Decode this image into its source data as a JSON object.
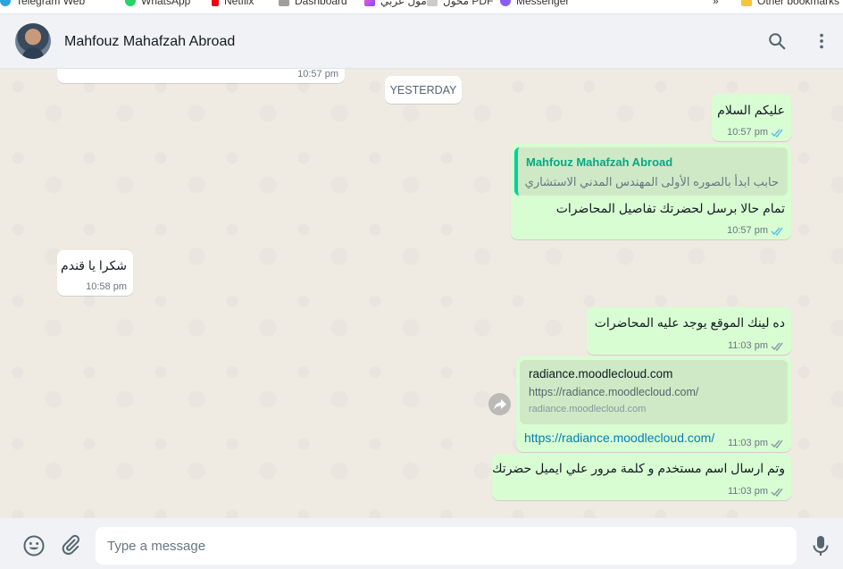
{
  "bookmarks": {
    "items": [
      {
        "label": "Telegram Web",
        "color": "#2aa3df"
      },
      {
        "label": "WhatsApp",
        "color": "#25d366"
      },
      {
        "label": "Netflix",
        "color": "#e50914"
      },
      {
        "label": "Dashboard",
        "color": "#9e9e9e"
      },
      {
        "label": "مول عربي",
        "color": "#a64dff"
      },
      {
        "label": "محول PDF",
        "color": "#cccccc"
      },
      {
        "label": "Messenger",
        "color": "#8a5cf6"
      }
    ],
    "more": "»",
    "other": "Other bookmarks"
  },
  "header": {
    "contact_name": "Mahfouz Mahafzah Abroad",
    "icons": [
      "search-icon",
      "menu-icon"
    ]
  },
  "chat": {
    "date_chip": "YESTERDAY",
    "top_partial_time": "10:57 pm",
    "messages": [
      {
        "dir": "out",
        "text": "عليكم السلام",
        "time": "10:57 pm",
        "status": "read"
      },
      {
        "dir": "out",
        "quote_author": "Mahfouz Mahafzah Abroad",
        "quote_text": "حابب ابدأ بالصوره الأولى المهندس المدني الاستشاري",
        "text": "تمام حالا برسل لحضرتك تفاصيل المحاضرات",
        "time": "10:57 pm",
        "status": "read"
      },
      {
        "dir": "in",
        "text": "شكرا يا قندم",
        "time": "10:58 pm"
      },
      {
        "dir": "out",
        "text": "ده لينك الموقع يوجد عليه المحاضرات",
        "time": "11:03 pm",
        "status": "delivered"
      },
      {
        "dir": "out",
        "preview_title": "radiance.moodlecloud.com",
        "preview_desc": "https://radiance.moodlecloud.com/",
        "preview_domain": "radiance.moodlecloud.com",
        "link": "https://radiance.moodlecloud.com/",
        "time": "11:03 pm",
        "status": "delivered"
      },
      {
        "dir": "out",
        "text": "وتم ارسال اسم مستخدم و كلمة مرور علي ايميل حضرتك",
        "time": "11:03 pm",
        "status": "delivered"
      }
    ]
  },
  "footer": {
    "placeholder": "Type a message",
    "value": ""
  },
  "colors": {
    "read_tick": "#53bdeb",
    "delivered_tick": "#8696a0",
    "outgoing_bubble": "#d9fdd3",
    "incoming_bubble": "#ffffff"
  }
}
